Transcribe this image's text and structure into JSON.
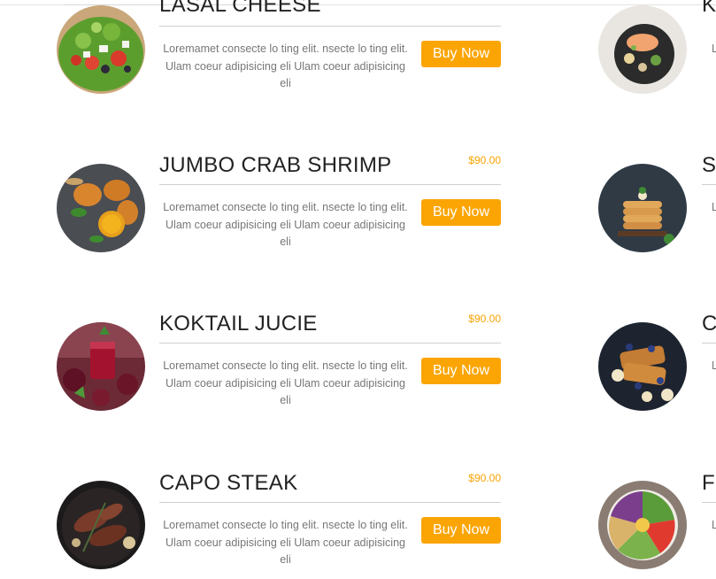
{
  "menu": {
    "left_items": [
      {
        "title": "LASAL CHEESE",
        "price": "",
        "desc": "Loremamet consecte lo ting elit. nsecte lo ting elit. Ulam coeur adipisicing eli Ulam coeur adipisicing eli",
        "button": "Buy Now",
        "image": "salad-photo"
      },
      {
        "title": "JUMBO CRAB SHRIMP",
        "price": "$90.00",
        "desc": "Loremamet consecte lo ting elit. nsecte lo ting elit. Ulam coeur adipisicing eli Ulam coeur adipisicing eli",
        "button": "Buy Now",
        "image": "crab-shrimp-photo"
      },
      {
        "title": "KOKTAIL JUCIE",
        "price": "$90.00",
        "desc": "Loremamet consecte lo ting elit. nsecte lo ting elit. Ulam coeur adipisicing eli Ulam coeur adipisicing eli",
        "button": "Buy Now",
        "image": "juice-photo"
      },
      {
        "title": "CAPO STEAK",
        "price": "$90.00",
        "desc": "Loremamet consecte lo ting elit. nsecte lo ting elit. Ulam coeur adipisicing eli Ulam coeur adipisicing eli",
        "button": "Buy Now",
        "image": "steak-photo"
      }
    ],
    "right_items": [
      {
        "title_partial": "K",
        "desc_partial": "L",
        "image": "salmon-plate-photo"
      },
      {
        "title_partial": "S",
        "desc_partial": "L",
        "image": "pancakes-photo"
      },
      {
        "title_partial": "C",
        "desc_partial": "L",
        "image": "french-toast-photo"
      },
      {
        "title_partial": "F",
        "desc_partial": "L",
        "image": "buddha-bowl-photo"
      }
    ]
  },
  "colors": {
    "accent": "#fba504",
    "price": "#f7a400",
    "title": "#222222",
    "text": "#777777"
  }
}
